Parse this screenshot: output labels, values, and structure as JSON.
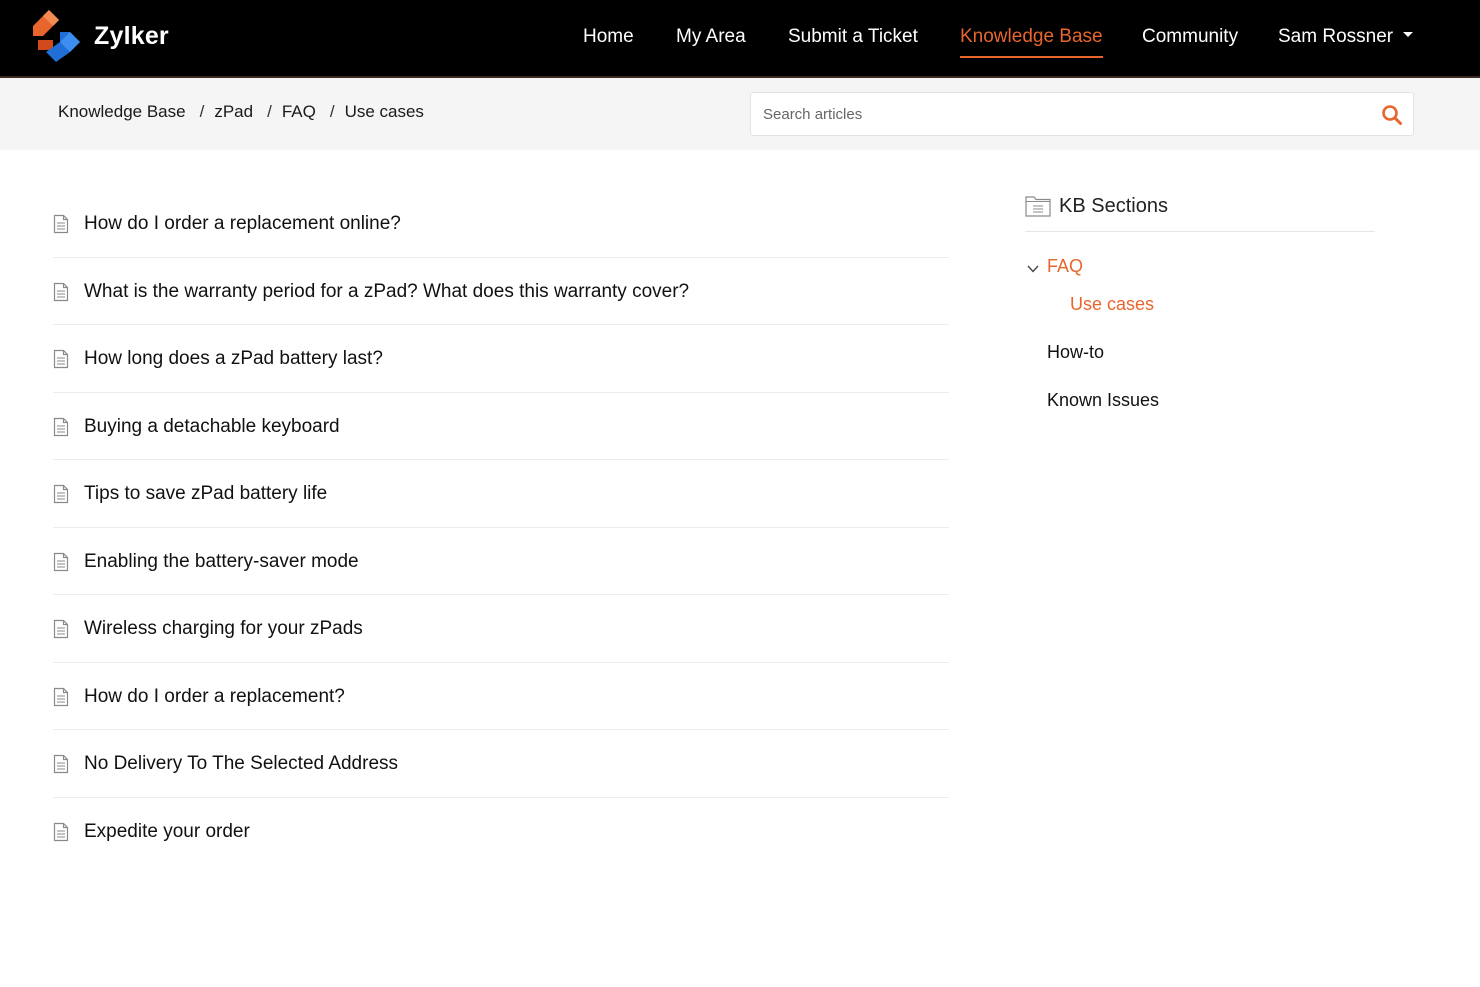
{
  "brand": {
    "name": "Zylker",
    "logo": "zylker-logo"
  },
  "nav": {
    "items": [
      {
        "label": "Home",
        "active": false
      },
      {
        "label": "My Area",
        "active": false
      },
      {
        "label": "Submit a Ticket",
        "active": false
      },
      {
        "label": "Knowledge Base",
        "active": true
      },
      {
        "label": "Community",
        "active": false
      }
    ],
    "user": "Sam Rossner"
  },
  "breadcrumb": [
    "Knowledge Base",
    "zPad",
    "FAQ",
    "Use cases"
  ],
  "search": {
    "placeholder": "Search articles",
    "value": "",
    "icon": "search-icon"
  },
  "articles": [
    "How do I order a replacement online?",
    "What is the warranty period for a zPad? What does this warranty cover?",
    "How long does a zPad battery last?",
    "Buying a detachable keyboard",
    "Tips to save zPad battery life",
    "Enabling the battery-saver mode",
    "Wireless charging for your zPads",
    "How do I order a replacement?",
    "No Delivery To The Selected Address",
    "Expedite your order"
  ],
  "kb_sections": {
    "title": "KB Sections",
    "items": [
      {
        "label": "FAQ",
        "expanded": true,
        "active": true
      },
      {
        "label": "Use cases",
        "active": true
      },
      {
        "label": "How-to",
        "active": false
      },
      {
        "label": "Known Issues",
        "active": false
      }
    ]
  },
  "colors": {
    "accent": "#e8662e",
    "topbar": "#000000",
    "subbar": "#f5f5f5"
  }
}
